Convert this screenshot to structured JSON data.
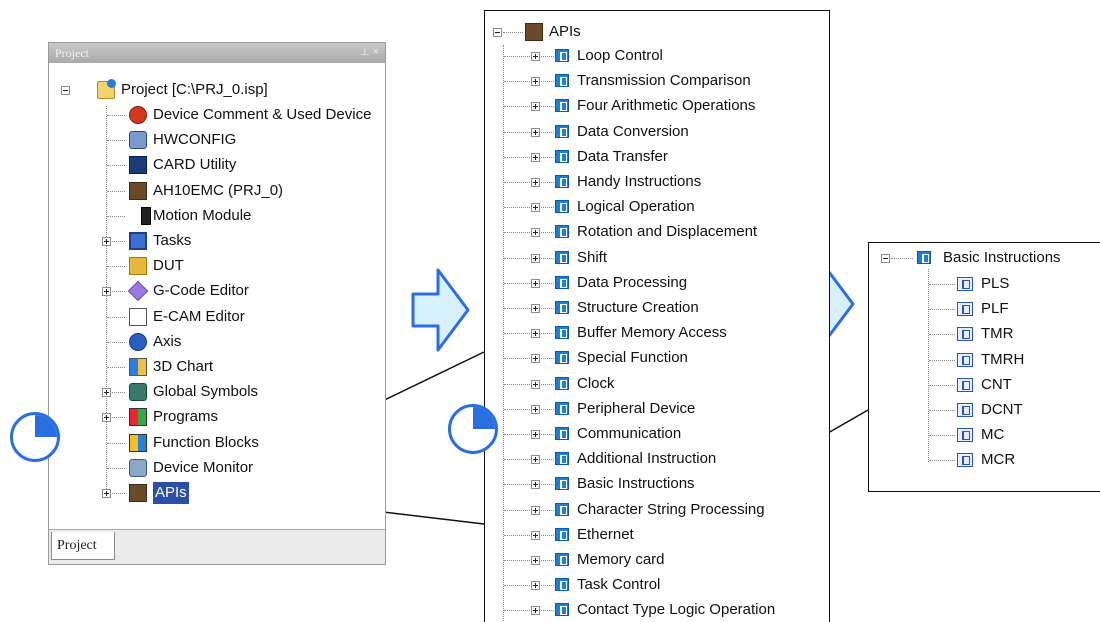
{
  "project_panel": {
    "title": "Project",
    "title_icons": "⊥ ×",
    "bottom_tab": "Project",
    "root_label": "Project [C:\\PRJ_0.isp]",
    "items": [
      {
        "label": "Device Comment & Used Device",
        "icon": "device-comment-icon",
        "expander": false
      },
      {
        "label": "HWCONFIG",
        "icon": "hwconfig-icon",
        "expander": false
      },
      {
        "label": "CARD Utility",
        "icon": "card-utility-icon",
        "expander": false
      },
      {
        "label": "AH10EMC  (PRJ_0)",
        "icon": "plc-icon",
        "expander": false
      },
      {
        "label": "Motion Module",
        "icon": "motion-module-icon",
        "expander": false
      },
      {
        "label": "Tasks",
        "icon": "tasks-icon",
        "expander": true
      },
      {
        "label": "DUT",
        "icon": "dut-icon",
        "expander": false
      },
      {
        "label": "G-Code Editor",
        "icon": "gcode-editor-icon",
        "expander": true
      },
      {
        "label": "E-CAM Editor",
        "icon": "ecam-editor-icon",
        "expander": false
      },
      {
        "label": "Axis",
        "icon": "axis-icon",
        "expander": false
      },
      {
        "label": "3D Chart",
        "icon": "3d-chart-icon",
        "expander": false
      },
      {
        "label": "Global Symbols",
        "icon": "global-symbols-icon",
        "expander": true
      },
      {
        "label": "Programs",
        "icon": "programs-icon",
        "expander": true
      },
      {
        "label": "Function Blocks",
        "icon": "function-blocks-icon",
        "expander": false
      },
      {
        "label": "Device Monitor",
        "icon": "device-monitor-icon",
        "expander": false
      },
      {
        "label": "APIs",
        "icon": "apis-icon",
        "expander": true
      }
    ]
  },
  "apis_panel": {
    "root_label": "APIs",
    "items": [
      "Loop Control",
      "Transmission Comparison",
      "Four Arithmetic Operations",
      "Data Conversion",
      "Data Transfer",
      "Handy Instructions",
      "Logical Operation",
      "Rotation and Displacement",
      "Shift",
      "Data Processing",
      "Structure Creation",
      "Buffer Memory Access",
      "Special Function",
      "Clock",
      "Peripheral Device",
      "Communication",
      "Additional Instruction",
      "Basic Instructions",
      "Character String Processing",
      "Ethernet",
      "Memory card",
      "Task Control",
      "Contact Type Logic Operation"
    ]
  },
  "basic_panel": {
    "root_label": "Basic Instructions",
    "items": [
      "PLS",
      "PLF",
      "TMR",
      "TMRH",
      "CNT",
      "DCNT",
      "MC",
      "MCR"
    ]
  },
  "colors": {
    "arrow_fill": "#d6f1fb",
    "arrow_stroke": "#2c6de0",
    "api_icon": "#1f7fd6",
    "pointer": "#2a6fe0"
  }
}
